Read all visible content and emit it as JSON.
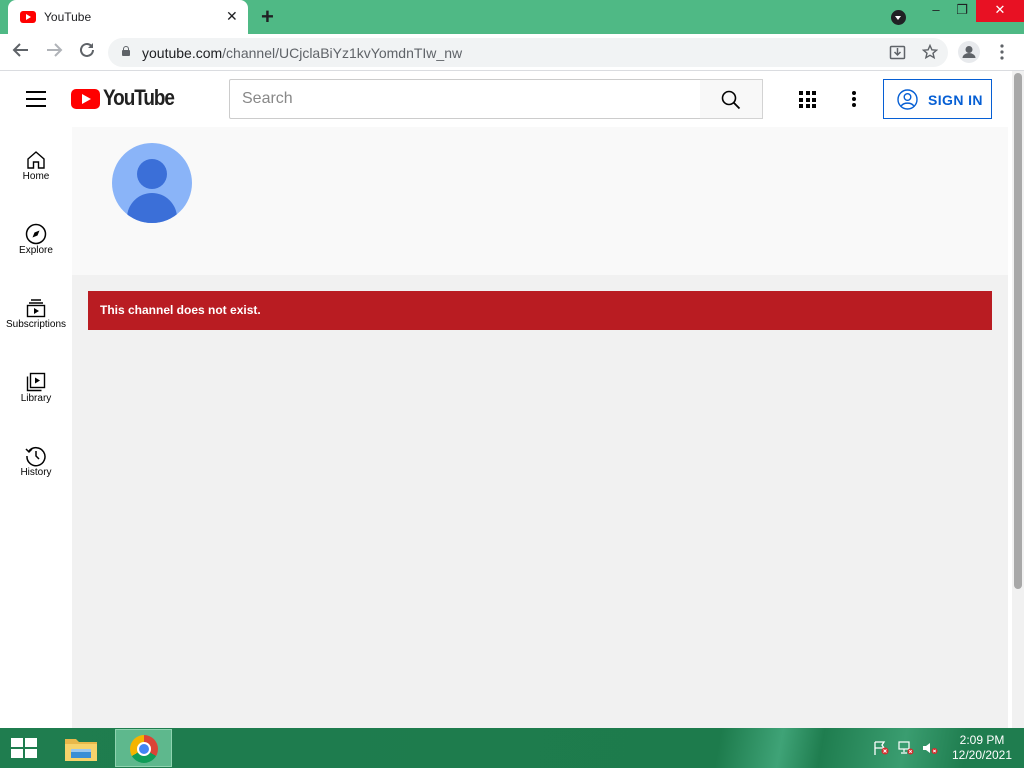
{
  "browser": {
    "tab_title": "YouTube",
    "url_domain": "youtube.com",
    "url_path": "/channel/UCjclaBiYz1kvYomdnTIw_nw",
    "window_controls": {
      "minimize": "–",
      "restore": "❐",
      "close": "✕"
    }
  },
  "youtube": {
    "logo_text": "YouTube",
    "search_placeholder": "Search",
    "sign_in_label": "SIGN IN",
    "guide": [
      {
        "label": "Home",
        "icon": "home-icon"
      },
      {
        "label": "Explore",
        "icon": "compass-icon"
      },
      {
        "label": "Subscriptions",
        "icon": "subscriptions-icon"
      },
      {
        "label": "Library",
        "icon": "library-icon"
      },
      {
        "label": "History",
        "icon": "history-icon"
      }
    ],
    "error_message": "This channel does not exist."
  },
  "taskbar": {
    "time": "2:09 PM",
    "date": "12/20/2021"
  },
  "colors": {
    "tabbar": "#4fb985",
    "brand_red": "#ff0000",
    "error_banner": "#b91c22",
    "sign_in_blue": "#065fd4",
    "taskbar": "#1f7d4f"
  }
}
